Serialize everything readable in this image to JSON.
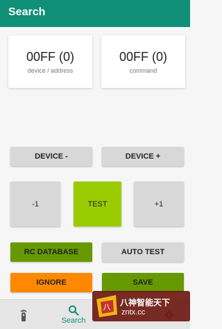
{
  "appbar": {
    "title": "Search"
  },
  "cards": {
    "device": {
      "value": "00FF (0)",
      "caption": "device / address"
    },
    "command": {
      "value": "00FF (0)",
      "caption": "command"
    }
  },
  "buttons": {
    "device_minus": "DEVICE -",
    "device_plus": "DEVICE +",
    "minus1": "-1",
    "test": "TEST",
    "plus1": "+1",
    "rc_database": "RC DATABASE",
    "auto_test": "AUTO TEST",
    "ignore": "IGNORE",
    "save": "SAVE"
  },
  "bottom_nav": {
    "items": [
      {
        "icon": "remote-icon",
        "label": ""
      },
      {
        "icon": "search-icon",
        "label": "Search",
        "active": true
      },
      {
        "icon": "gear-icon",
        "label": ""
      }
    ]
  },
  "watermark": {
    "text": "八神智能天下",
    "url": "zntx.cc"
  },
  "colors": {
    "primary": "#0f8f77",
    "test_button": "#99cc00",
    "green_button": "#669900",
    "orange_button": "#ff8800",
    "neutral_button": "#d8d8d8",
    "background": "#f6f6f6"
  }
}
